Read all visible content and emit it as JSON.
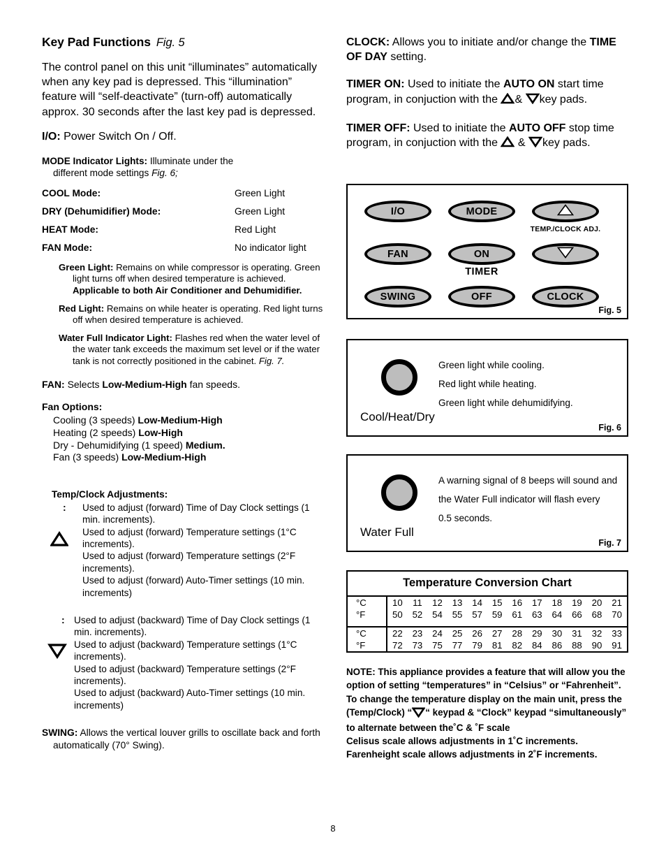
{
  "page_number": "8",
  "left_column": {
    "title": "Key Pad Functions",
    "title_figref": "Fig. 5",
    "intro": "The control panel on this unit “illuminates” automatically when any key pad is depressed.  This “illumination” feature will “self-deactivate” (turn-off) automatically approx. 30 seconds after the last key pad is depressed.",
    "io_label": "I/O:",
    "io_text": "Power Switch On / Off.",
    "mode_heading": "MODE Indicator Lights:",
    "mode_heading_text": "Illuminate under the",
    "mode_heading_text2": "different mode settings",
    "mode_heading_figref": "Fig. 6;",
    "mode_rows": [
      {
        "label": "COOL Mode:",
        "value": "Green Light"
      },
      {
        "label": "DRY (Dehumidifier) Mode:",
        "value": "Green Light"
      },
      {
        "label": "HEAT Mode:",
        "value": "Red Light"
      },
      {
        "label": "FAN Mode:",
        "value": "No indicator light"
      }
    ],
    "green_light_label": "Green Light:",
    "green_light_text": "Remains on while compressor is operating.  Green light turns off when desired temperature is achieved. ",
    "green_light_bold_tail": "Applicable to both Air Conditioner and Dehumidifier.",
    "red_light_label": "Red Light:",
    "red_light_text": "Remains on while heater is operating.  Red light turns off when desired temperature is achieved.",
    "water_full_label": "Water Full Indicator Light:",
    "water_full_text": "Flashes red when the water level of the water tank exceeds the maximum set level or if the water tank is not correctly positioned in the cabinet. ",
    "water_full_figref": "Fig. 7.",
    "fan_label": "FAN:",
    "fan_text_1": "Selects ",
    "fan_text_bold": "Low-Medium-High",
    "fan_text_2": " fan speeds.",
    "fan_options_heading": "Fan Options:",
    "fan_options": [
      {
        "text": "Cooling (3 speeds) ",
        "bold": "Low-Medium-High"
      },
      {
        "text": "Heating (2 speeds) ",
        "bold": "Low-High"
      },
      {
        "text": "Dry - Dehumidifying (1 speed) ",
        "bold": "Medium."
      },
      {
        "text": "Fan (3 speeds) ",
        "bold": "Low-Medium-High"
      }
    ],
    "adjust_heading": "Temp/Clock Adjustments:",
    "up_group": {
      "icon": "triangle-up-icon",
      "colon": ":",
      "lines": [
        "Used to adjust (forward) Time of Day Clock settings (1 min. increments).",
        "Used to adjust (forward) Temperature settings (1°C increments).",
        "Used to adjust (forward) Temperature settings (2°F increments).",
        "Used to adjust (forward) Auto-Timer settings (10 min. increments)"
      ]
    },
    "down_group": {
      "icon": "triangle-down-icon",
      "colon": ":",
      "lines": [
        "Used to adjust (backward) Time of Day Clock settings (1 min. increments).",
        "Used to adjust (backward) Temperature settings (1°C increments).",
        "Used to adjust (backward) Temperature settings (2°F increments).",
        "Used to adjust (backward) Auto-Timer settings (10 min. increments)"
      ]
    },
    "swing_label": "SWING:",
    "swing_text": "Allows the vertical louver grills to oscillate back and forth automatically (70° Swing)."
  },
  "right_column": {
    "clock_label": "CLOCK:",
    "clock_text_1": "Allows you to initiate and/or change the ",
    "clock_text_bold": "TIME OF DAY",
    "clock_text_2": " setting.",
    "timer_on_label": "TIMER ON:",
    "timer_on_text_1": "Used to initiate the ",
    "timer_on_bold": "AUTO ON",
    "timer_on_text_2": " start time program, in conjuction with the ",
    "timer_on_amp": "&",
    "timer_on_text_3": "key pads.",
    "timer_off_label": "TIMER OFF:",
    "timer_off_text_1": "Used to initiate the ",
    "timer_off_bold": "AUTO OFF",
    "timer_off_text_2": " stop time program, in conjuction with the ",
    "timer_off_amp": "&",
    "timer_off_text_3": "key pads."
  },
  "fig5": {
    "caption": "Fig. 5",
    "keys": [
      {
        "id": "io",
        "label": "I/O"
      },
      {
        "id": "mode",
        "label": "MODE"
      },
      {
        "id": "up",
        "label": "",
        "icon": "triangle-up-icon"
      },
      {
        "id": "fan",
        "label": "FAN"
      },
      {
        "id": "on",
        "label": "ON"
      },
      {
        "id": "down",
        "label": "",
        "icon": "triangle-down-icon"
      },
      {
        "id": "swing",
        "label": "SWING"
      },
      {
        "id": "off",
        "label": "OFF"
      },
      {
        "id": "clock",
        "label": "CLOCK"
      }
    ],
    "temp_clock_adj_label": "TEMP./CLOCK ADJ.",
    "timer_label": "TIMER"
  },
  "fig6": {
    "caption": "Fig. 6",
    "indicator_caption": "Cool/Heat/Dry",
    "lines": [
      "Green light while cooling.",
      "Red light while heating.",
      "Green light while dehumidifying."
    ],
    "dot_color": "#bdbdbd"
  },
  "fig7": {
    "caption": "Fig. 7",
    "indicator_caption": "Water Full",
    "lines": [
      "A warning signal of 8 beeps will sound and",
      "the Water Full indicator will flash every",
      "0.5 seconds."
    ],
    "dot_color": "#bdbdbd"
  },
  "chart_data": {
    "type": "table",
    "title": "Temperature Conversion Chart",
    "row_labels": [
      "°C",
      "°F"
    ],
    "blocks": [
      {
        "celsius": [
          10,
          11,
          12,
          13,
          14,
          15,
          16,
          17,
          18,
          19,
          20,
          21
        ],
        "fahrenheit": [
          50,
          52,
          54,
          55,
          57,
          59,
          61,
          63,
          64,
          66,
          68,
          70
        ]
      },
      {
        "celsius": [
          22,
          23,
          24,
          25,
          26,
          27,
          28,
          29,
          30,
          31,
          32,
          33
        ],
        "fahrenheit": [
          72,
          73,
          75,
          77,
          79,
          81,
          82,
          84,
          86,
          88,
          90,
          91
        ]
      }
    ]
  },
  "note": {
    "lines": [
      "NOTE: This appliance provides a feature that will allow you the",
      "option of setting “temperatures” in “Celsius” or “Fahrenheit”.",
      "To change the temperature display on the main unit, press the"
    ],
    "line4_a": "(Temp/Clock) “",
    "line4_b": "“ keypad & “Clock” keypad “simultaneously”",
    "line5": "to alternate between the˚C & ˚F scale",
    "line6": "Celisus scale allows adjustments in 1˚C increments.",
    "line7": "Farenheight scale allows adjustments in 2˚F increments."
  }
}
